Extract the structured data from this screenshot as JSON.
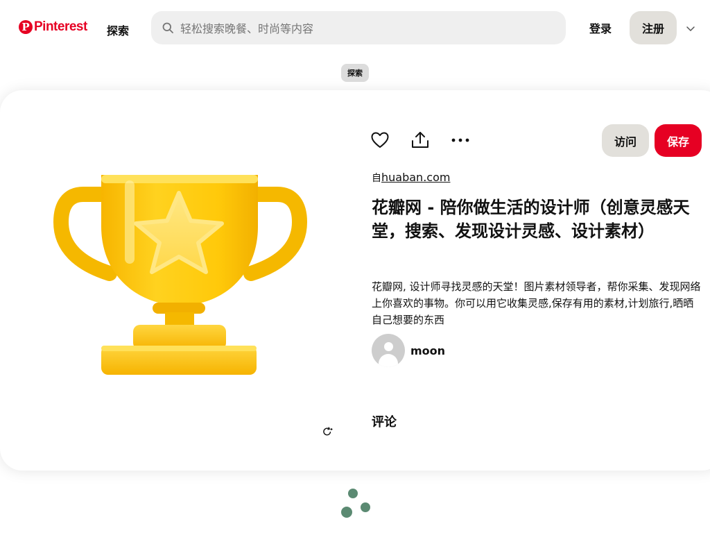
{
  "header": {
    "logo_text": "Pinterest",
    "logo_mark": "P",
    "explore_label": "探索",
    "search_placeholder": "轻松搜索晚餐、时尚等内容",
    "login_label": "登录",
    "signup_label": "注册",
    "more_icon": "chevron-down-icon"
  },
  "breadcrumb": {
    "label": "探索"
  },
  "pin": {
    "source_prefix": "自",
    "source_domain": "huaban.com",
    "visit_label": "访问",
    "save_label": "保存",
    "title": "花瓣网 - 陪你做生活的设计师（创意灵感天堂，搜索、发现设计灵感、设计素材）",
    "description": "花瓣网, 设计师寻找灵感的天堂！图片素材领导者，帮你采集、发现网络上你喜欢的事物。你可以用它收集灵感,保存有用的素材,计划旅行,晒晒自己想要的东西",
    "author_name": "moon",
    "comments_heading": "评论",
    "image_subject": "trophy-icon",
    "action_icons": [
      "heart-icon",
      "share-icon",
      "more-icon"
    ]
  },
  "colors": {
    "brand_red": "#e60023",
    "secondary_button": "#e2e0db",
    "search_bg": "#efefef",
    "trophy_gold": "#fcc419",
    "loader_green": "#5b8a72"
  }
}
